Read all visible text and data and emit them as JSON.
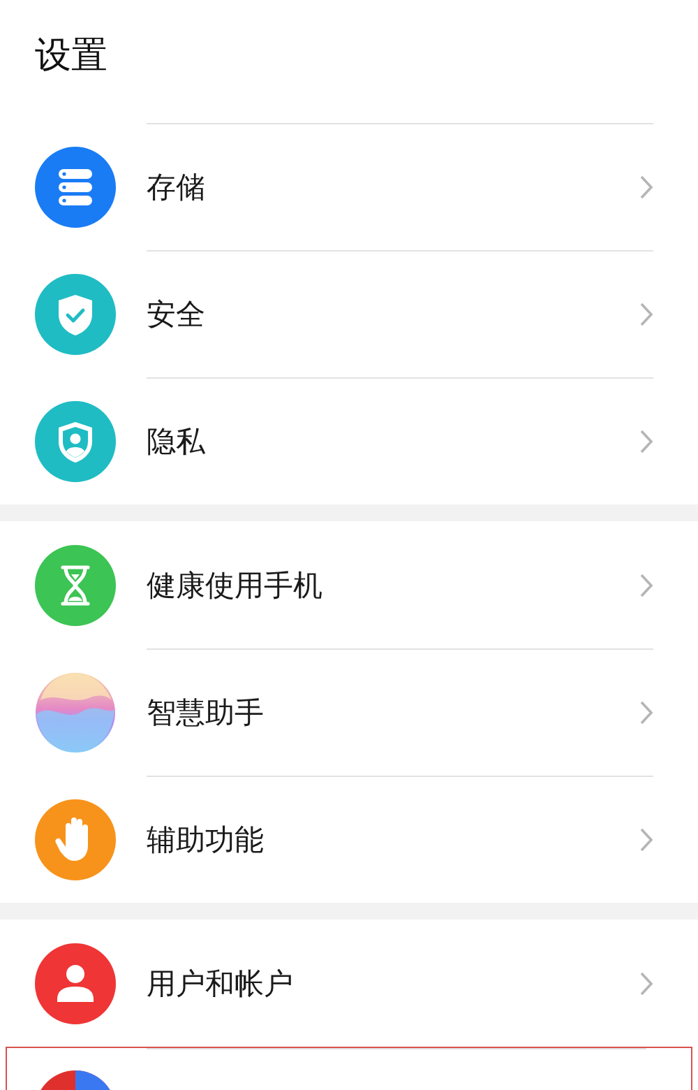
{
  "title": "设置",
  "groups": [
    {
      "items": [
        {
          "kind": "storage",
          "label": "存储",
          "outlined": false
        },
        {
          "kind": "security",
          "label": "安全",
          "outlined": false
        },
        {
          "kind": "privacy",
          "label": "隐私",
          "outlined": false
        }
      ]
    },
    {
      "items": [
        {
          "kind": "health",
          "label": "健康使用手机",
          "outlined": false
        },
        {
          "kind": "assistant",
          "label": "智慧助手",
          "outlined": false
        },
        {
          "kind": "accessibility",
          "label": "辅助功能",
          "outlined": false
        }
      ]
    },
    {
      "items": [
        {
          "kind": "user",
          "label": "用户和帐户",
          "outlined": false
        },
        {
          "kind": "ring",
          "outlined": true
        }
      ]
    }
  ]
}
